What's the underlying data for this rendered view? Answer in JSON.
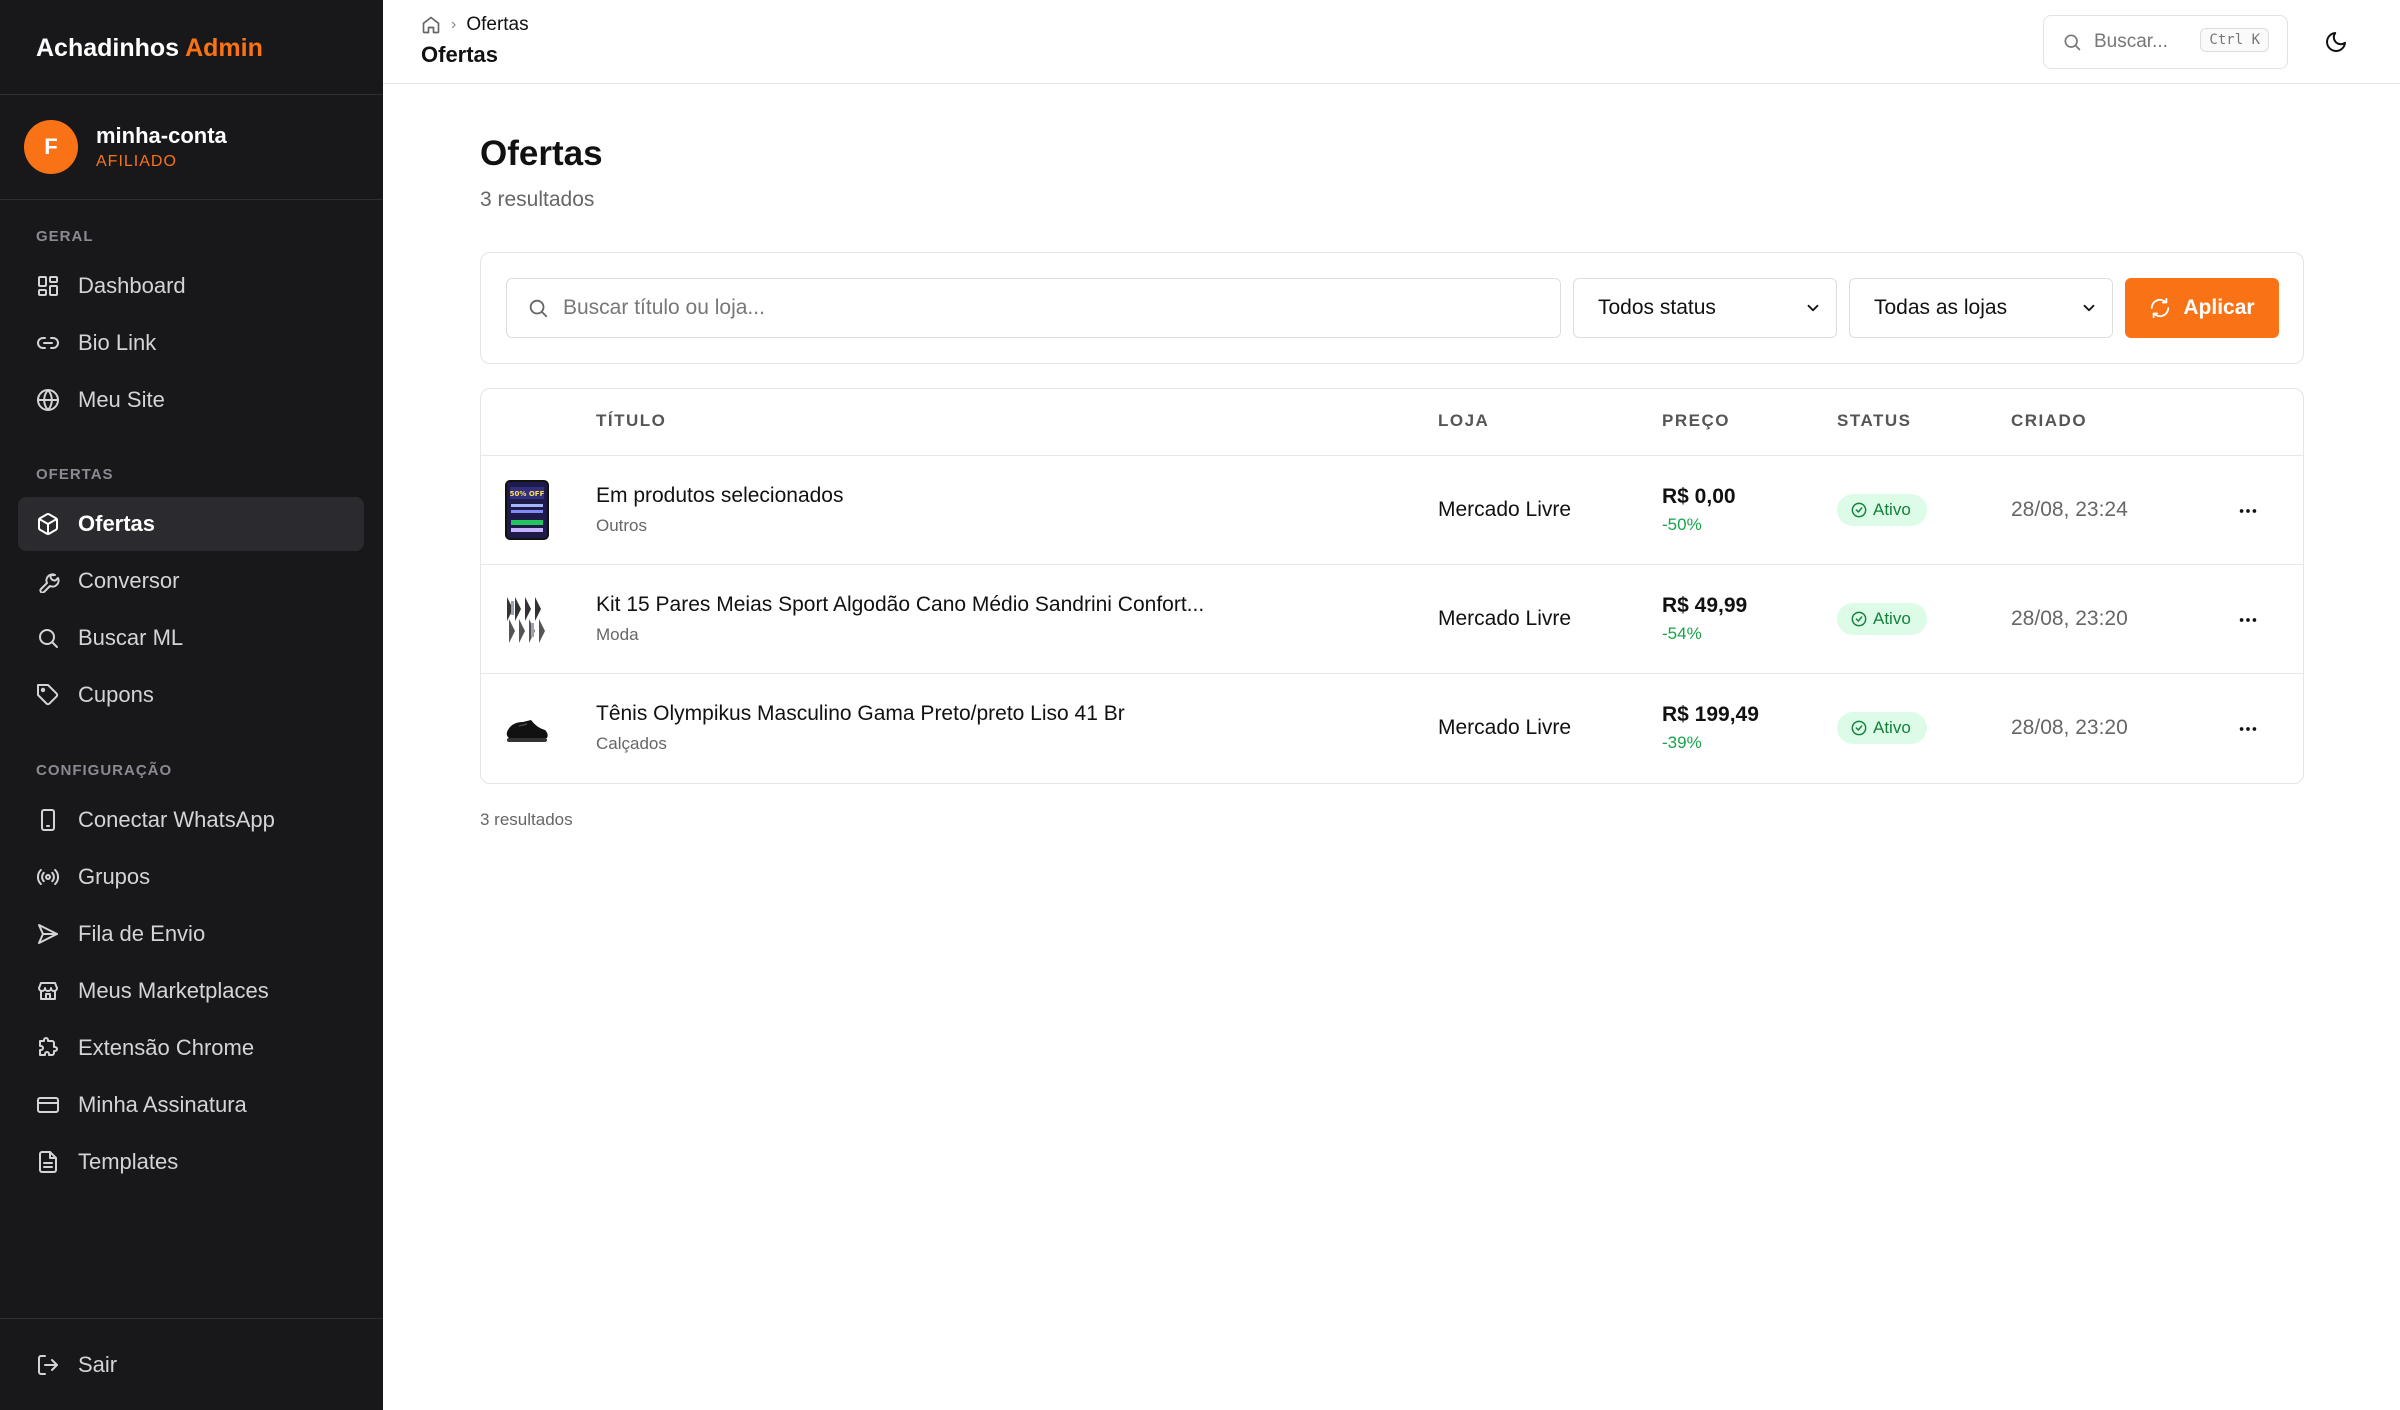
{
  "app": {
    "brand_name": "Achadinhos",
    "brand_accent": "Admin",
    "accent_color": "#f97316"
  },
  "account": {
    "initial": "F",
    "name": "minha-conta",
    "role": "AFILIADO"
  },
  "sidebar": {
    "sections": [
      {
        "label": "GERAL",
        "items": [
          {
            "label": "Dashboard",
            "icon": "dashboard-icon"
          },
          {
            "label": "Bio Link",
            "icon": "link-icon"
          },
          {
            "label": "Meu Site",
            "icon": "globe-icon"
          }
        ]
      },
      {
        "label": "OFERTAS",
        "items": [
          {
            "label": "Ofertas",
            "icon": "package-icon",
            "active": true
          },
          {
            "label": "Conversor",
            "icon": "wrench-icon"
          },
          {
            "label": "Buscar ML",
            "icon": "search-icon"
          },
          {
            "label": "Cupons",
            "icon": "tag-icon"
          }
        ]
      },
      {
        "label": "CONFIGURAÇÃO",
        "items": [
          {
            "label": "Conectar WhatsApp",
            "icon": "smartphone-icon"
          },
          {
            "label": "Grupos",
            "icon": "radio-icon"
          },
          {
            "label": "Fila de Envio",
            "icon": "send-icon"
          },
          {
            "label": "Meus Marketplaces",
            "icon": "store-icon"
          },
          {
            "label": "Extensão Chrome",
            "icon": "puzzle-icon"
          },
          {
            "label": "Minha Assinatura",
            "icon": "credit-card-icon"
          },
          {
            "label": "Templates",
            "icon": "file-text-icon"
          }
        ]
      }
    ],
    "logout": {
      "label": "Sair",
      "icon": "logout-icon"
    }
  },
  "topbar": {
    "breadcrumb": [
      "Ofertas"
    ],
    "title": "Ofertas",
    "search_placeholder": "Buscar...",
    "search_shortcut": "Ctrl K"
  },
  "page": {
    "title": "Ofertas",
    "subtitle": "3 resultados",
    "footer_count": "3 resultados"
  },
  "filters": {
    "search_placeholder": "Buscar título ou loja...",
    "status_selected": "Todos status",
    "store_selected": "Todas as lojas",
    "apply_label": "Aplicar"
  },
  "table": {
    "headers": {
      "title": "TÍTULO",
      "store": "LOJA",
      "price": "PREÇO",
      "status": "STATUS",
      "created": "CRIADO"
    },
    "rows": [
      {
        "title": "Em produtos selecionados",
        "category": "Outros",
        "store": "Mercado Livre",
        "price": "R$ 0,00",
        "discount": "-50%",
        "status": "Ativo",
        "created": "28/08, 23:24",
        "thumb_badge": "50% OFF"
      },
      {
        "title": "Kit 15 Pares Meias Sport Algodão Cano Médio Sandrini Confort...",
        "category": "Moda",
        "store": "Mercado Livre",
        "price": "R$ 49,99",
        "discount": "-54%",
        "status": "Ativo",
        "created": "28/08, 23:20"
      },
      {
        "title": "Tênis Olympikus Masculino Gama Preto/preto Liso 41 Br",
        "category": "Calçados",
        "store": "Mercado Livre",
        "price": "R$ 199,49",
        "discount": "-39%",
        "status": "Ativo",
        "created": "28/08, 23:20"
      }
    ]
  }
}
